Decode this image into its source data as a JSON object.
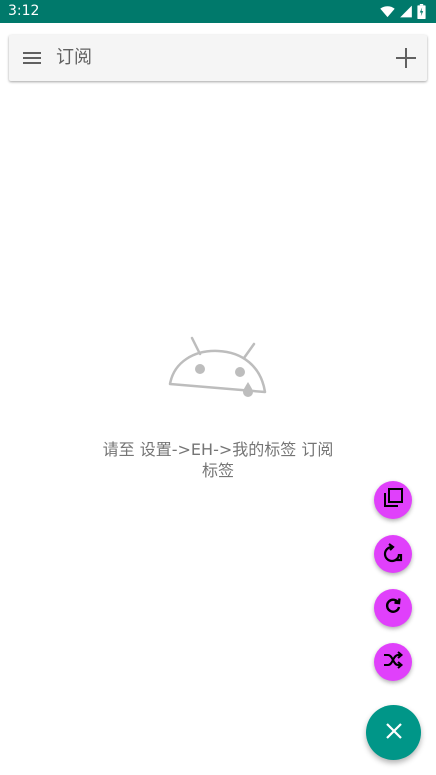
{
  "status_bar": {
    "time": "3:12",
    "icons": [
      "wifi-icon",
      "cellular-signal-icon",
      "battery-icon"
    ]
  },
  "toolbar": {
    "title": "订阅",
    "menu_icon": "menu-icon",
    "add_icon": "plus-icon"
  },
  "empty_state": {
    "icon": "sad-android-icon",
    "message": "请至 设置->EH->我的标签 订阅标签"
  },
  "fab_menu": {
    "items": [
      {
        "icon": "copy-icon"
      },
      {
        "icon": "rotate-refresh-icon"
      },
      {
        "icon": "refresh-icon"
      },
      {
        "icon": "shuffle-icon"
      }
    ],
    "main_icon": "close-icon"
  },
  "colors": {
    "status_bar": "#00796b",
    "toolbar_bg": "#f5f5f5",
    "fab_mini": "#e040fb",
    "fab_main": "#009688",
    "text_secondary": "#757575"
  }
}
